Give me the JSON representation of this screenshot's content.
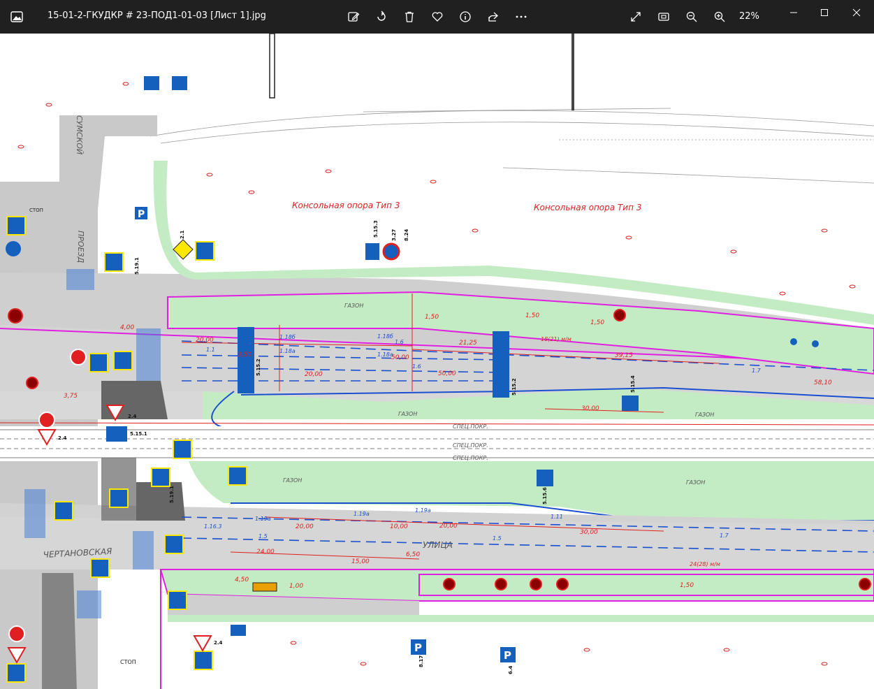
{
  "window": {
    "title": "15-01-2-ГКУДКР # 23-ПОД1-01-03 [Лист 1].jpg",
    "zoom": "22%"
  },
  "drawing": {
    "labels": {
      "opora1": "Консольная опора Тип 3",
      "opora2": "Консольная опора Тип 3",
      "gazon": "ГАЗОН",
      "ulica": "УЛИЦА",
      "chertanovskaya": "ЧЕРТАНОВСКАЯ",
      "proezd": "ПРОЕЗД",
      "sumskoy": "СУМСКОЙ",
      "stop": "СТОП",
      "spec": "СПЕЦ.ПОКР."
    },
    "dims": {
      "d2000a": "20,00",
      "d5000a": "50,00",
      "d5000b": "50,00",
      "d2000b": "20,00",
      "d2125": "21,25",
      "d3915": "39,15",
      "d5810": "58,10",
      "d3000a": "30,00",
      "d3000b": "30,00",
      "d2400": "24,00",
      "d1500": "15,00",
      "d650": "6,50",
      "d1000": "10,00",
      "d2000c": "20,00",
      "d2000d": "20,00",
      "d150a": "1,50",
      "d150b": "1,50",
      "d150c": "1,50",
      "d150d": "1,50",
      "d400": "4,00",
      "d375": "3,75",
      "d350": "3,50",
      "d1800": "18(21) м/м",
      "d2400m": "24(28) м/м",
      "d450": "4,50",
      "d100": "1,00"
    },
    "marks": {
      "m118b": "1.18б",
      "m118a": "1.18а",
      "m16": "1.6",
      "m11": "1.1",
      "m119a": "1.19а",
      "m15": "1.5",
      "m17": "1.7",
      "m111": "1.11",
      "m1163": "1.16.3"
    },
    "signs": {
      "s5152": "5.15.2",
      "s5151": "5.15.1",
      "s5156": "5.15.6",
      "s5154": "5.15.4",
      "s5191": "5.19.1",
      "s24": "2.4",
      "s21": "2.1",
      "s327": "3.27",
      "s824": "8.24",
      "s5153": "5.15.3",
      "s617": "8.17",
      "s64": "6.4"
    }
  },
  "colors": {
    "road": "#c9c9c9",
    "grass": "#c4ecc4",
    "curb": "#e020e0",
    "dimension": "#e02020",
    "marking": "#1a4fd0",
    "sign": "#1560bd",
    "titlebar": "#202020"
  }
}
